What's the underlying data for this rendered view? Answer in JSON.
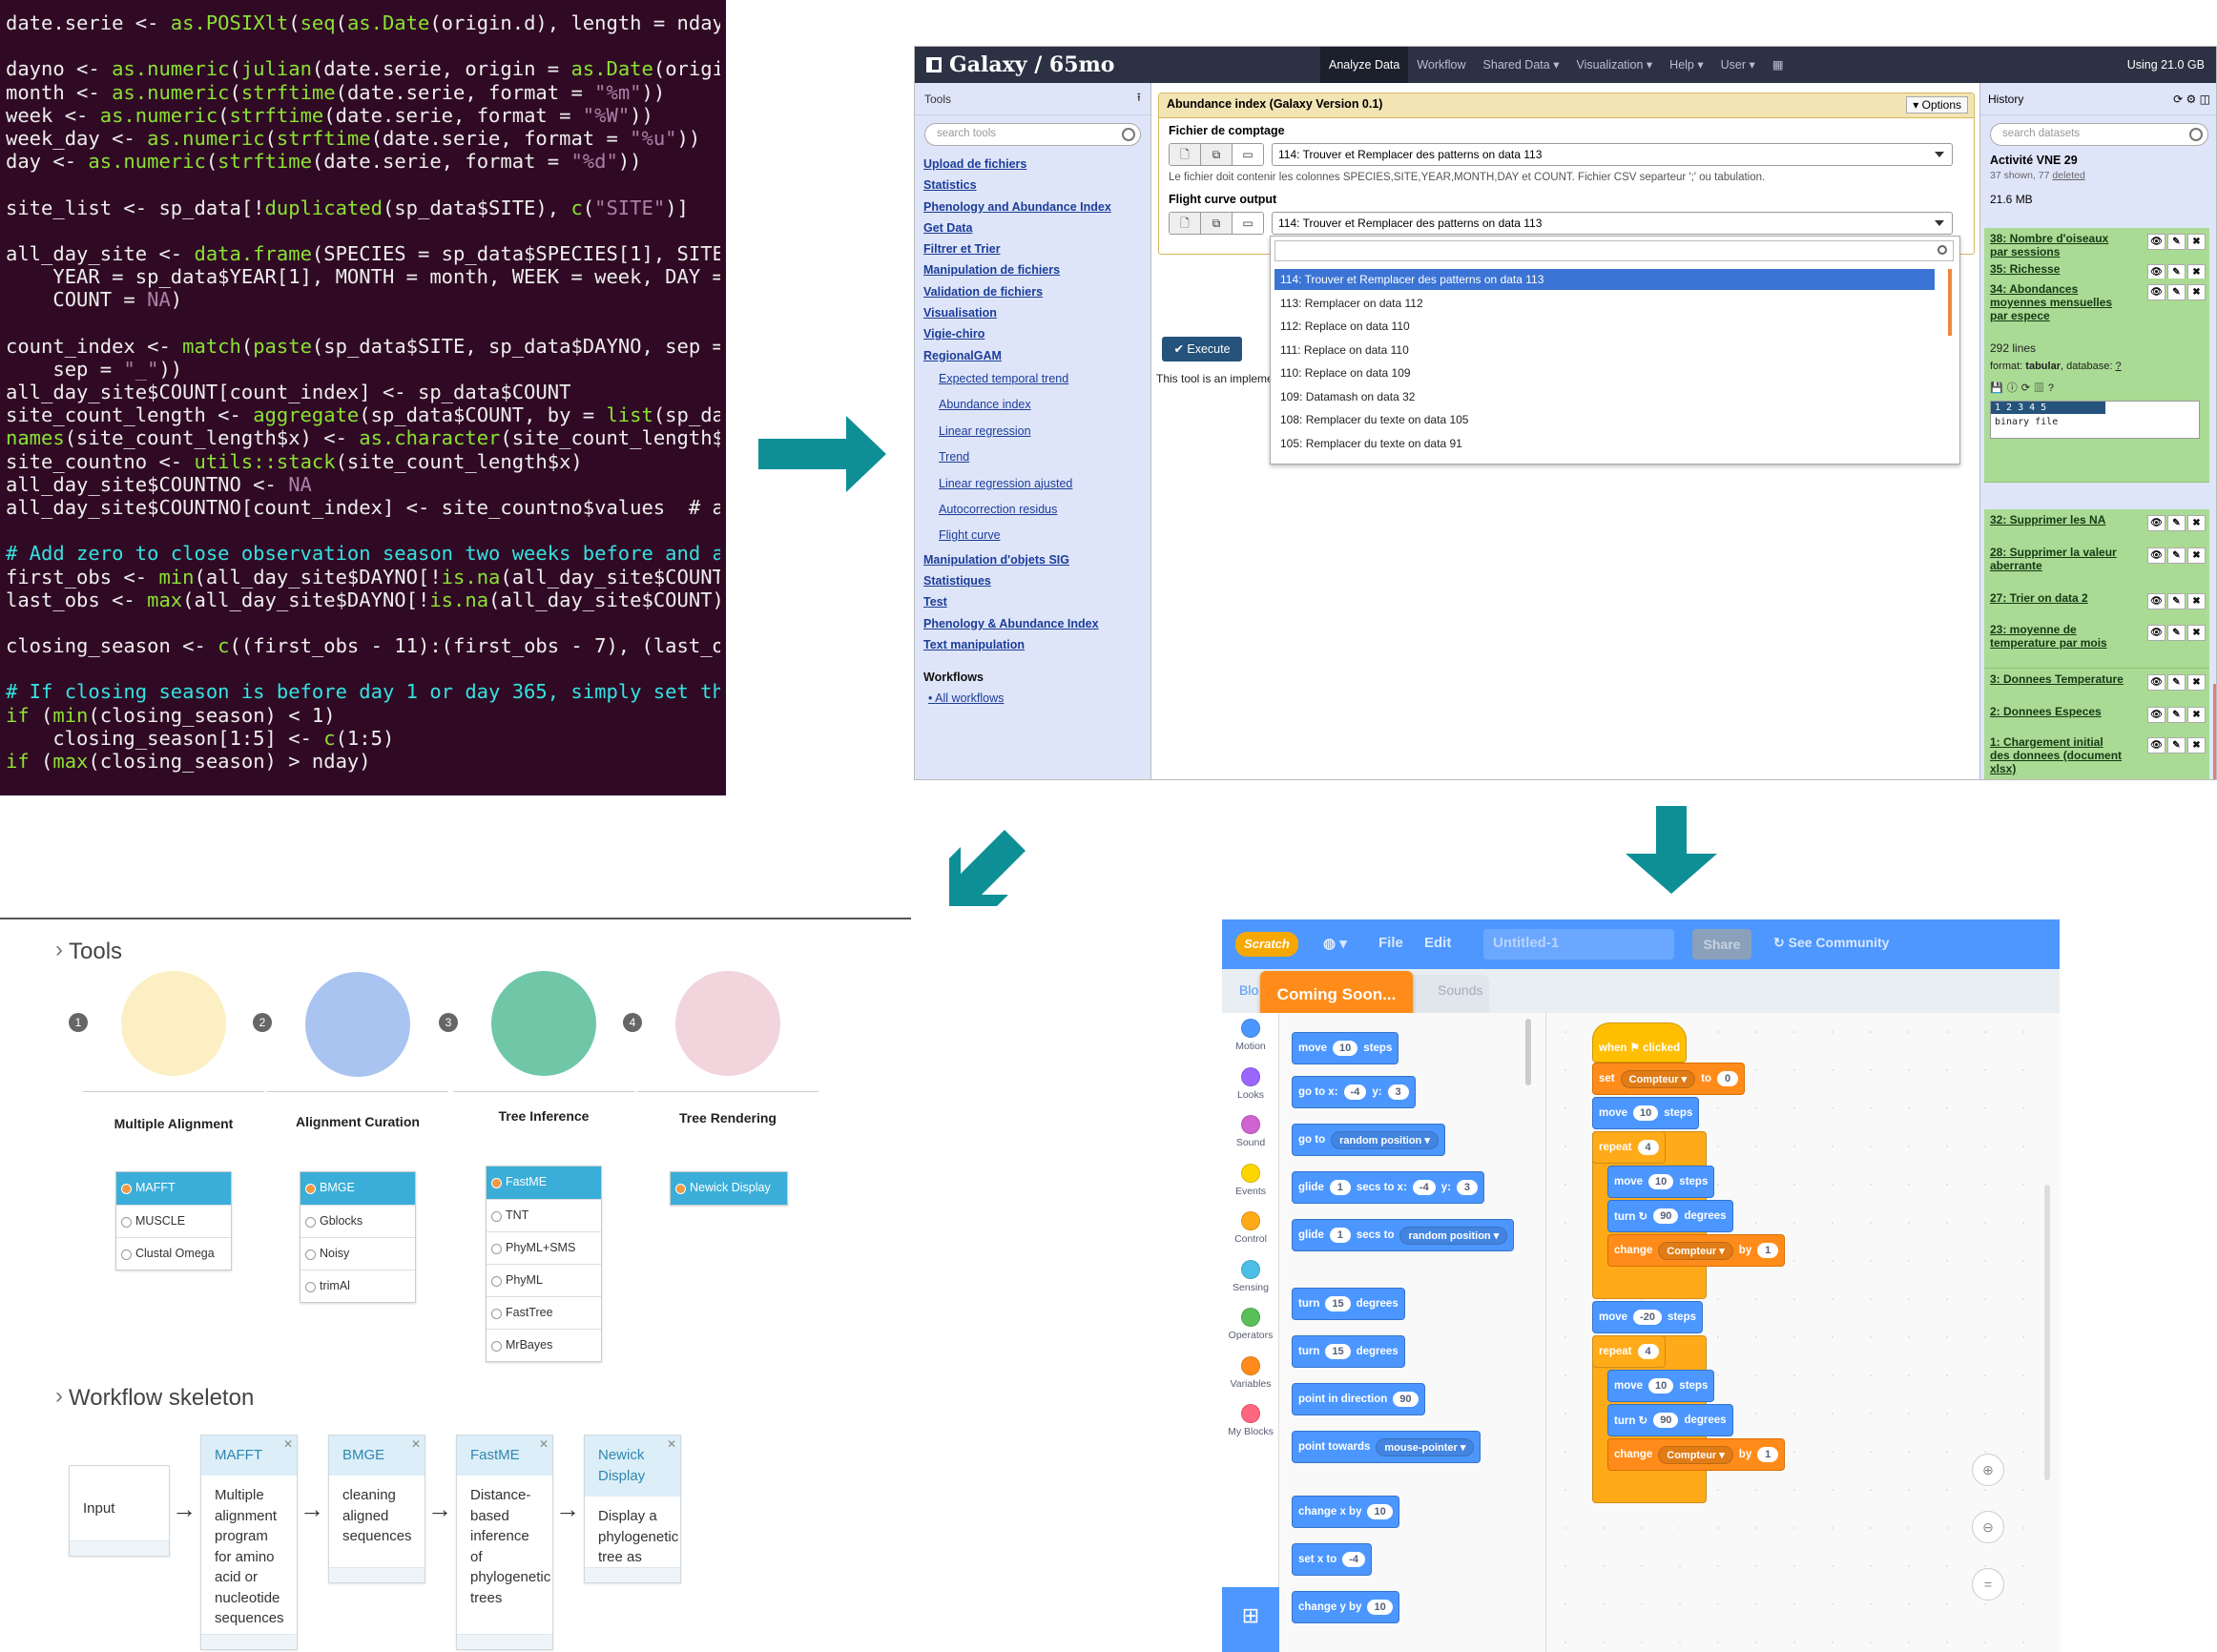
{
  "code": {
    "lines": [
      "date.serie <- as.POSIXlt(seq(as.Date(origin.d), length = nday,",
      "",
      "dayno <- as.numeric(julian(date.serie, origin = as.Date(origin.",
      "month <- as.numeric(strftime(date.serie, format = \"%m\"))",
      "week <- as.numeric(strftime(date.serie, format = \"%W\"))",
      "week_day <- as.numeric(strftime(date.serie, format = \"%u\"))",
      "day <- as.numeric(strftime(date.serie, format = \"%d\"))",
      "",
      "site_list <- sp_data[!duplicated(sp_data$SITE), c(\"SITE\")]",
      "",
      "all_day_site <- data.frame(SPECIES = sp_data$SPECIES[1], SITE =",
      "    YEAR = sp_data$YEAR[1], MONTH = month, WEEK = week, DAY = d",
      "    COUNT = NA)",
      "",
      "count_index <- match(paste(sp_data$SITE, sp_data$DAYNO, sep = \"",
      "    sep = \"_\"))",
      "all_day_site$COUNT[count_index] <- sp_data$COUNT",
      "site_count_length <- aggregate(sp_data$COUNT, by = list(sp_data",
      "names(site_count_length$x) <- as.character(site_count_length$Gr",
      "site_countno <- utils::stack(site_count_length$x)",
      "all_day_site$COUNTNO <- NA",
      "all_day_site$COUNTNO[count_index] <- site_countno$values  # add",
      "",
      "# Add zero to close observation season two weeks before and aft",
      "first_obs <- min(all_day_site$DAYNO[!is.na(all_day_site$COUNT)]",
      "last_obs <- max(all_day_site$DAYNO[!is.na(all_day_site$COUNT)])",
      "",
      "closing_season <- c((first_obs - 11):(first_obs - 7), (last_obs",
      "",
      "# If closing season is before day 1 or day 365, simply set the",
      "if (min(closing_season) < 1)",
      "    closing_season[1:5] <- c(1:5)",
      "if (max(closing_season) > nday)"
    ]
  },
  "galaxy": {
    "brand": "Galaxy / 65mo",
    "nav": [
      "Analyze Data",
      "Workflow",
      "Shared Data ▾",
      "Visualization ▾",
      "Help ▾",
      "User ▾",
      "▦"
    ],
    "using": "Using 21.0 GB",
    "tools_header": "Tools",
    "tools_search": "search tools",
    "tool_links": [
      "Upload de fichiers",
      "Statistics",
      "Phenology and Abundance Index",
      "Get Data",
      "Filtrer et Trier",
      "Manipulation de fichiers",
      "Validation de fichiers",
      "Visualisation",
      "Vigie-chiro",
      "RegionalGAM"
    ],
    "tool_sub_links": [
      "Expected temporal trend",
      "Abundance index",
      "Linear regression",
      "Trend",
      "Linear regression ajusted",
      "Autocorrection residus",
      "Flight curve"
    ],
    "tool_links_2": [
      "Manipulation d'objets SIG",
      "Statistiques",
      "Test",
      "Phenology & Abundance Index",
      "Text manipulation"
    ],
    "workflows_header": "Workflows",
    "all_workflows": "All workflows",
    "form_title": "Abundance index (Galaxy Version 0.1)",
    "options": "▾ Options",
    "field1_label": "Fichier de comptage",
    "field1_value": "114: Trouver et Remplacer des patterns on data 113",
    "field1_help": "Le fichier doit contenir les colonnes SPECIES,SITE,YEAR,MONTH,DAY et COUNT. Fichier CSV separteur ';' ou tabulation.",
    "field2_label": "Flight curve output",
    "field2_value": "114: Trouver et Remplacer des patterns on data 113",
    "execute": "✔ Execute",
    "impl_text": "This tool is an impleme",
    "dropdown_items": [
      "114: Trouver et Remplacer des patterns on data 113",
      "113: Remplacer on data 112",
      "112: Replace on data 110",
      "111: Replace on data 110",
      "110: Replace on data 109",
      "109: Datamash on data 32",
      "108: Remplacer du texte on data 105",
      "105: Remplacer du texte on data 91"
    ],
    "history_header": "History",
    "history_search": "search datasets",
    "history_name": "Activité VNE 29",
    "history_shown": "37 shown, 77",
    "history_deleted": "deleted",
    "history_size": "21.6 MB",
    "history_items": [
      "38: Nombre d'oiseaux par sessions",
      "35: Richesse",
      "34: Abondances moyennes mensuelles par espece",
      "32: Supprimer les NA",
      "28: Supprimer la valeur aberrante",
      "27: Trier on data 2",
      "23: moyenne de temperature par mois",
      "3: Donnees Temperature",
      "2: Donnees Especes",
      "1: Chargement initial des donnees (document xlsx)"
    ],
    "expanded_lines": "292 lines",
    "expanded_format_label": "format:",
    "expanded_format": "tabular",
    "expanded_db": ", database:",
    "expanded_db_val": "?",
    "peek_header": "1          2 3 4 5",
    "peek_body": "binary file"
  },
  "tree": {
    "tools_heading": "Tools",
    "tools": [
      {
        "num": "1",
        "title": "Multiple Alignment",
        "options": [
          "MAFFT",
          "MUSCLE",
          "Clustal Omega"
        ],
        "selected": 0,
        "color": "#fcefc4"
      },
      {
        "num": "2",
        "title": "Alignment Curation",
        "options": [
          "BMGE",
          "Gblocks",
          "Noisy",
          "trimAl"
        ],
        "selected": 0,
        "color": "#a9c4f0"
      },
      {
        "num": "3",
        "title": "Tree Inference",
        "options": [
          "FastME",
          "TNT",
          "PhyML+SMS",
          "PhyML",
          "FastTree",
          "MrBayes"
        ],
        "selected": 0,
        "color": "#6fc7a8"
      },
      {
        "num": "4",
        "title": "Tree Rendering",
        "options": [
          "Newick Display"
        ],
        "selected": 0,
        "color": "#f2d4dd"
      }
    ],
    "workflow_heading": "Workflow skeleton",
    "input_label": "Input",
    "steps": [
      {
        "name": "MAFFT",
        "desc": "Multiple alignment program for amino acid or nucleotide sequences"
      },
      {
        "name": "BMGE",
        "desc": "cleaning aligned sequences"
      },
      {
        "name": "FastME",
        "desc": "Distance-based inference of phylogenetic trees"
      },
      {
        "name": "Newick Display",
        "desc": "Display a phylogenetic tree as SVG"
      }
    ]
  },
  "scratch": {
    "logo": "Scratch",
    "file": "File",
    "edit": "Edit",
    "title": "Untitled-1",
    "share": "Share",
    "community": "↻ See Community",
    "coming_soon": "Coming Soon...",
    "tab_blocks": "Blo",
    "tab_sounds": "Sounds",
    "categories": [
      {
        "name": "Motion",
        "color": "#4c97ff"
      },
      {
        "name": "Looks",
        "color": "#9966ff"
      },
      {
        "name": "Sound",
        "color": "#cf63cf"
      },
      {
        "name": "Events",
        "color": "#ffd500"
      },
      {
        "name": "Control",
        "color": "#ffab19"
      },
      {
        "name": "Sensing",
        "color": "#4cbfe6"
      },
      {
        "name": "Operators",
        "color": "#59c059"
      },
      {
        "name": "Variables",
        "color": "#ff8c1a"
      },
      {
        "name": "My Blocks",
        "color": "#ff6680"
      }
    ],
    "palette": {
      "move": "move",
      "move_n": "10",
      "steps": "steps",
      "goto": "go to x:",
      "gx": "-4",
      "y": "y:",
      "gy": "3",
      "goto_random": "go to",
      "random_position": "random position ▾",
      "glide": "glide",
      "glide_n": "1",
      "secs_to_x": "secs to x:",
      "glx": "-4",
      "gly": "3",
      "secs_to": "secs to",
      "turn": "turn",
      "turn_n": "15",
      "degrees": "degrees",
      "point_dir": "point in direction",
      "point_n": "90",
      "point_towards": "point towards",
      "mouse_pointer": "mouse-pointer ▾",
      "change_x": "change x by",
      "cx": "10",
      "set_x": "set x to",
      "sx": "-4",
      "change_y": "change y by",
      "cy": "10"
    },
    "script": {
      "when_clicked": "when ⚑ clicked",
      "set": "set",
      "var": "Compteur ▾",
      "to": "to",
      "init": "0",
      "move": "move",
      "n10": "10",
      "steps": "steps",
      "repeat": "repeat",
      "rep": "4",
      "turn": "turn ↻",
      "deg90": "90",
      "degrees": "degrees",
      "change": "change",
      "by": "by",
      "one": "1",
      "neg20": "-20"
    }
  }
}
